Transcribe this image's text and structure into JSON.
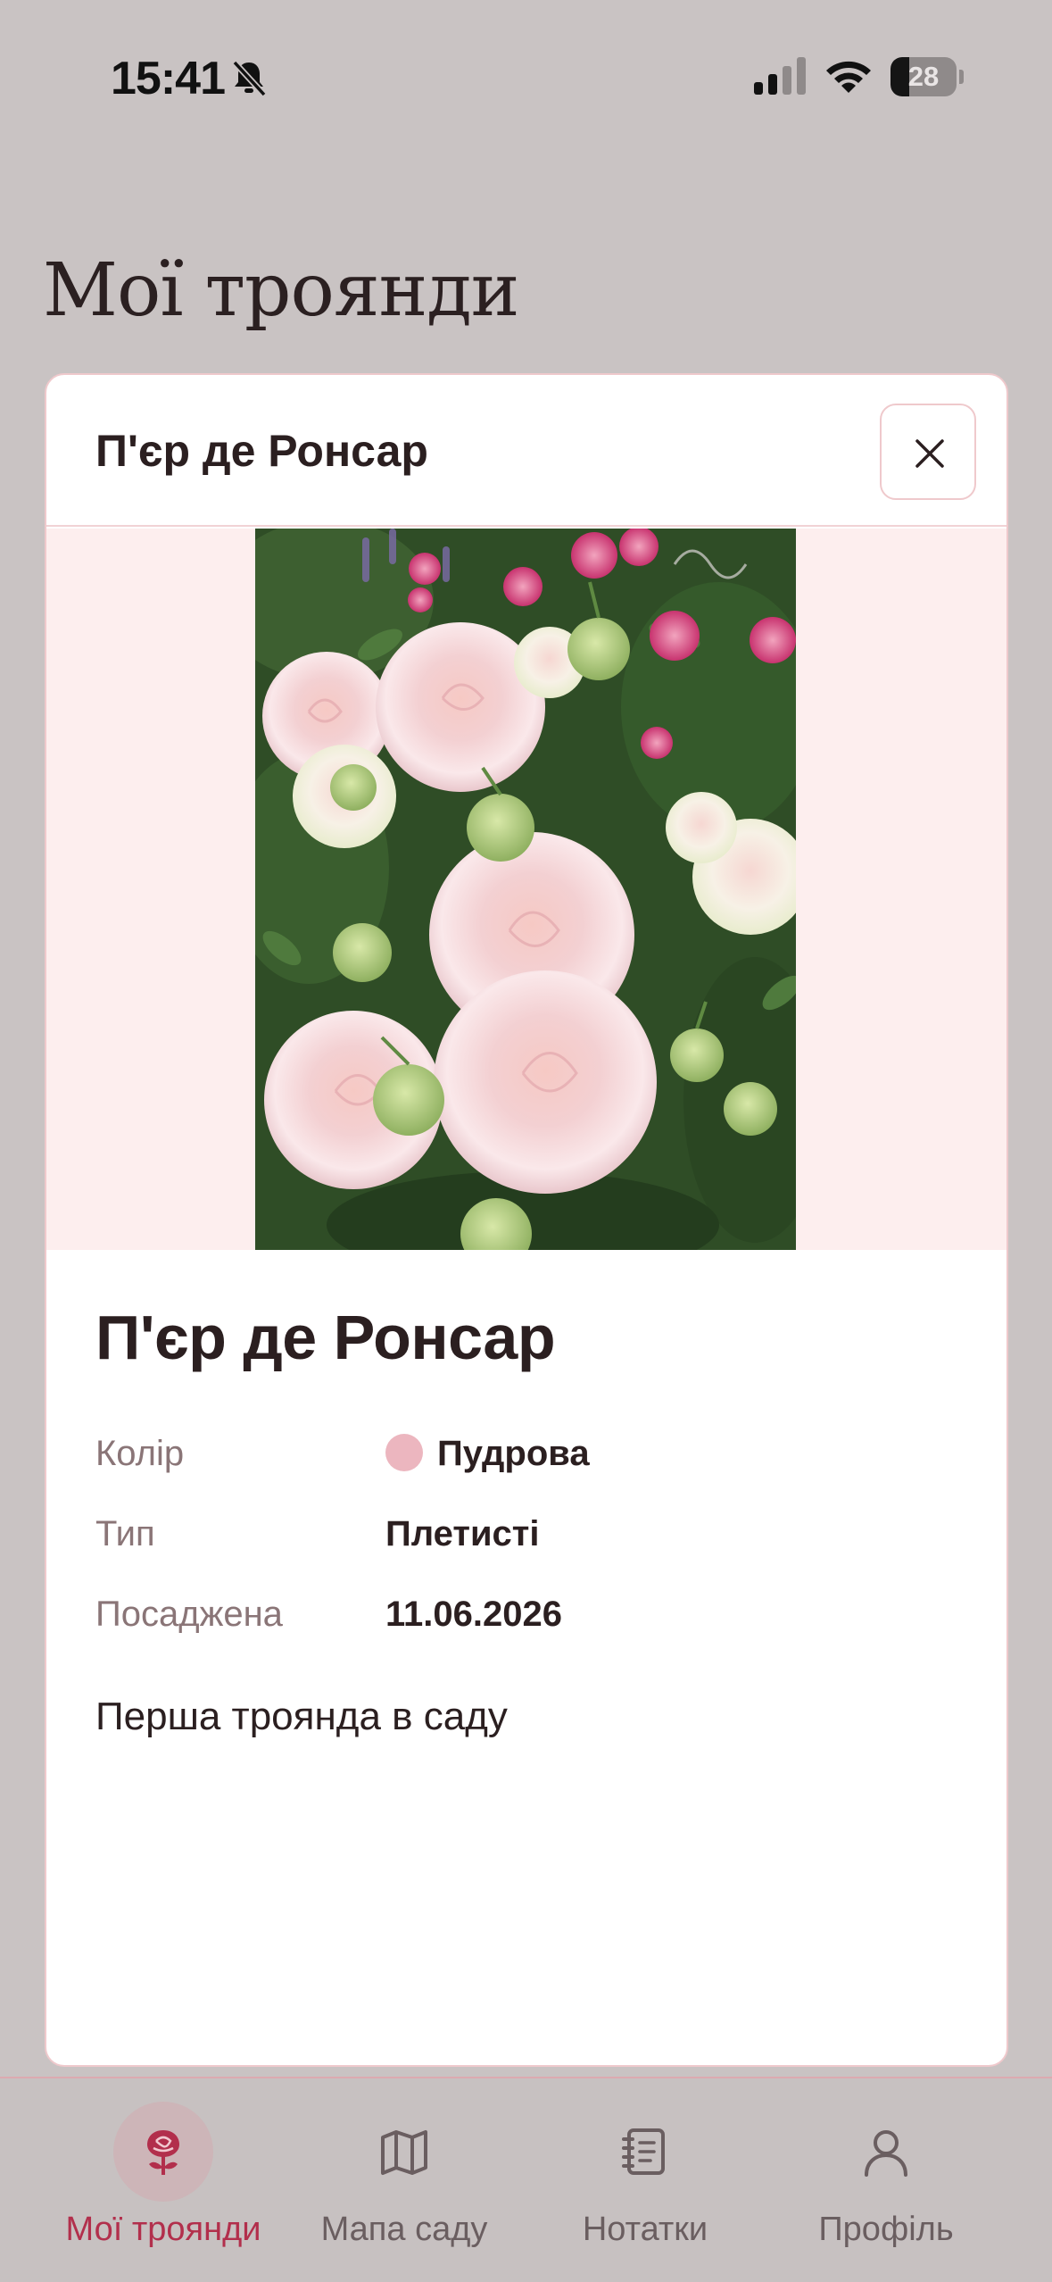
{
  "status_bar": {
    "time": "15:41",
    "battery_level": "28",
    "battery_fraction": 0.28
  },
  "page": {
    "title": "Мої троянди"
  },
  "modal": {
    "header_title": "П'єр де Ронсар",
    "close_icon": "close-icon",
    "photo_alt": "Пʼєр де Ронсар",
    "rose_name": "П'єр де Ронсар",
    "details": [
      {
        "label": "Колір",
        "value": "Пудрова",
        "swatch": "#ecb6bf"
      },
      {
        "label": "Тип",
        "value": "Плетисті"
      },
      {
        "label": "Посаджена",
        "value": "11.06.2026"
      }
    ],
    "note": "Перша троянда в саду"
  },
  "tabs": [
    {
      "label": "Мої троянди",
      "icon": "rose-icon",
      "active": true
    },
    {
      "label": "Мапа саду",
      "icon": "map-icon",
      "active": false
    },
    {
      "label": "Нотатки",
      "icon": "notebook-icon",
      "active": false
    },
    {
      "label": "Профіль",
      "icon": "user-icon",
      "active": false
    }
  ],
  "colors": {
    "accent": "#b22f4c",
    "backdrop": "#c9c3c3",
    "card_border": "#efc9cc",
    "photo_band": "#fdeeee"
  }
}
